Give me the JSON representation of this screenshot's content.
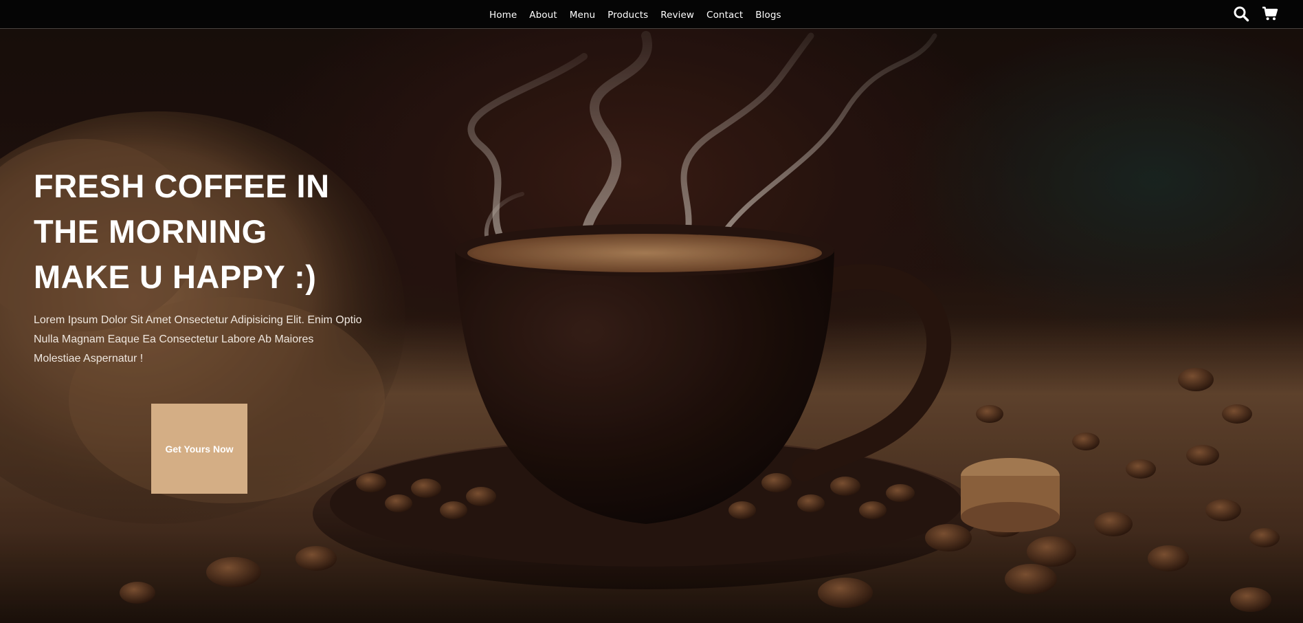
{
  "nav": {
    "items": [
      {
        "label": "Home"
      },
      {
        "label": "About"
      },
      {
        "label": "Menu"
      },
      {
        "label": "Products"
      },
      {
        "label": "Review"
      },
      {
        "label": "Contact"
      },
      {
        "label": "Blogs"
      }
    ],
    "icons": [
      "search-icon",
      "cart-icon"
    ]
  },
  "hero": {
    "title_lines": [
      "FRESH COFFEE IN",
      "THE MORNING",
      "MAKE U HAPPY :)"
    ],
    "description": "Lorem Ipsum Dolor Sit Amet Onsectetur Adipisicing Elit. Enim Optio Nulla Magnam Eaque Ea Consectetur Labore Ab Maiores Molestiae Aspernatur !",
    "cta_label": "Get Yours Now",
    "image": "hot-coffee-cup-with-steam-on-saucer-with-coffee-beans"
  },
  "colors": {
    "navbar_bg": "#050505",
    "cta_bg": "#d4ae85",
    "text": "#ffffff"
  }
}
